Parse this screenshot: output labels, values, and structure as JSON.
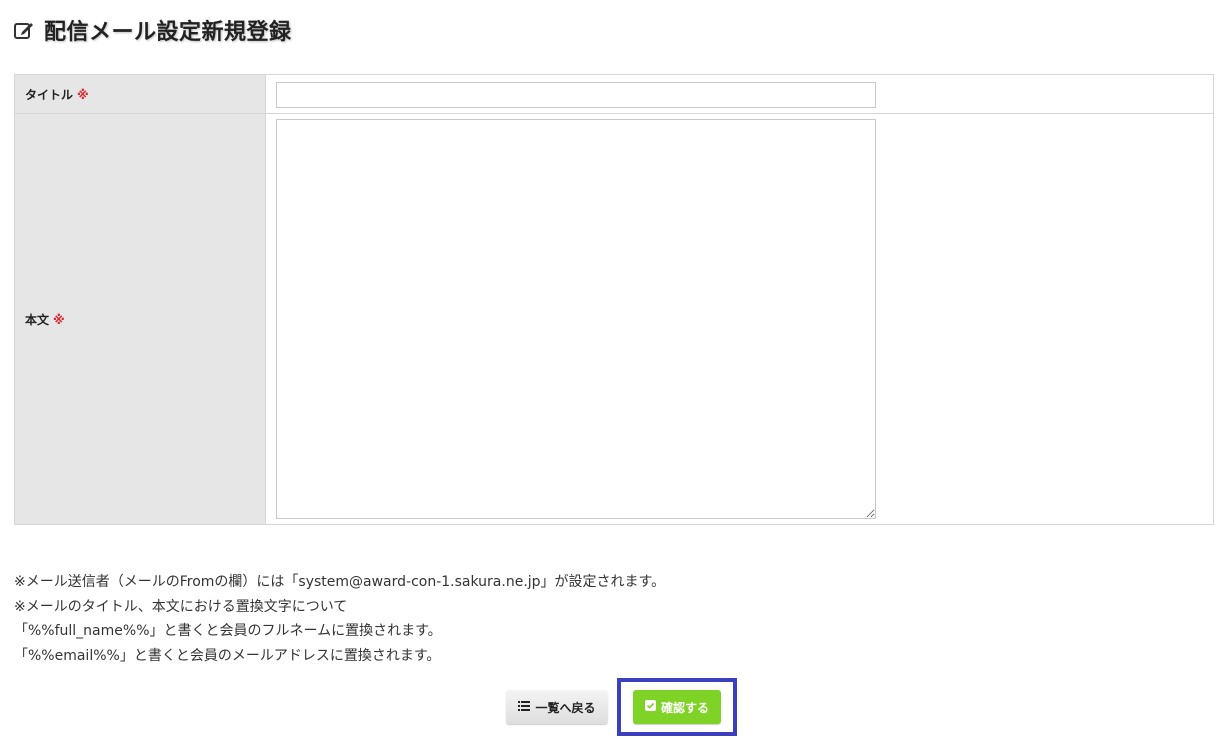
{
  "page": {
    "title": "配信メール設定新規登録",
    "title_icon": "edit-icon"
  },
  "form": {
    "title_field": {
      "label": "タイトル",
      "required_mark": "※",
      "value": "",
      "placeholder": ""
    },
    "body_field": {
      "label": "本文",
      "required_mark": "※",
      "value": "",
      "placeholder": ""
    }
  },
  "notes": [
    "※メール送信者（メールのFromの欄）には「system@award-con-1.sakura.ne.jp」が設定されます。",
    "※メールのタイトル、本文における置換文字について",
    "「%%full_name%%」と書くと会員のフルネームに置換されます。",
    "「%%email%%」と書くと会員のメールアドレスに置換されます。"
  ],
  "buttons": {
    "back_label": "一覧へ戻る",
    "back_icon": "list-icon",
    "confirm_label": "確認する",
    "confirm_icon": "check-square-icon"
  },
  "colors": {
    "required": "#d9272e",
    "confirm_button": "#7fd327",
    "highlight_border": "#3c3fbe",
    "label_background": "#e6e6e6"
  }
}
